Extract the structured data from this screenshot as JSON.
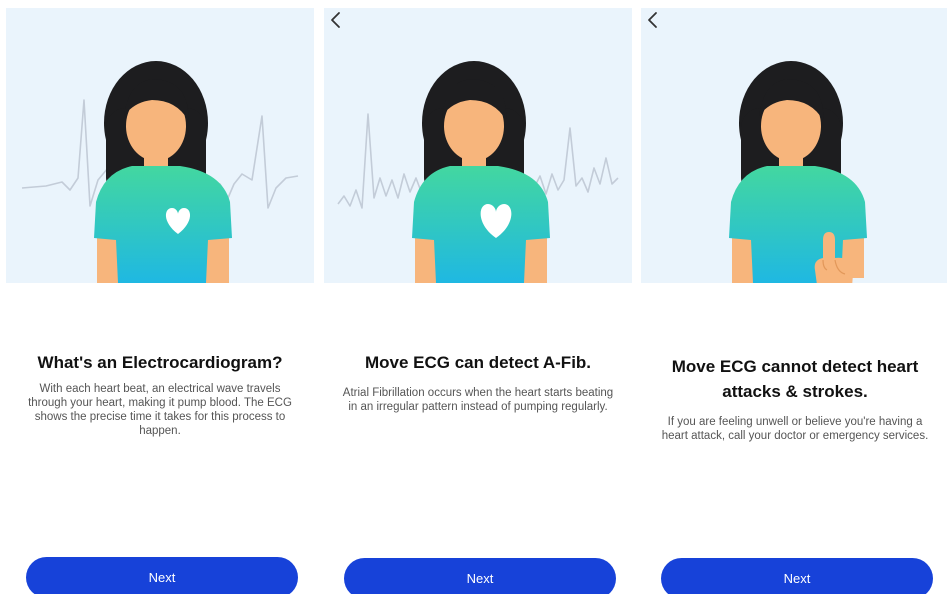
{
  "colors": {
    "accent": "#1742d9",
    "hero_background": "#eaf4fc",
    "ecg_line": "#c3ccd8",
    "shirt_top": "#43d7a0",
    "shirt_bottom": "#1fb8e2",
    "skin": "#f7b57c",
    "hair": "#1d1d1f"
  },
  "screens": [
    {
      "title": "What's an Electrocardiogram?",
      "body": "With each heart beat, an electrical wave travels through your heart, making it pump blood. The ECG shows the precise time it takes for this process to happen.",
      "button_label": "Next",
      "icon": "heart-icon"
    },
    {
      "back_icon": "chevron-left-icon",
      "title": "Move ECG can detect A-Fib.",
      "body": "Atrial Fibrillation occurs when the heart starts beating in an irregular pattern instead of pumping regularly.",
      "button_label": "Next",
      "icon": "heart-icon"
    },
    {
      "back_icon": "chevron-left-icon",
      "title": "Move ECG cannot detect heart attacks & strokes.",
      "body": "If you are feeling unwell or believe you're having a heart attack, call your doctor or emergency services.",
      "button_label": "Next",
      "icon": "raised-finger-icon"
    }
  ]
}
